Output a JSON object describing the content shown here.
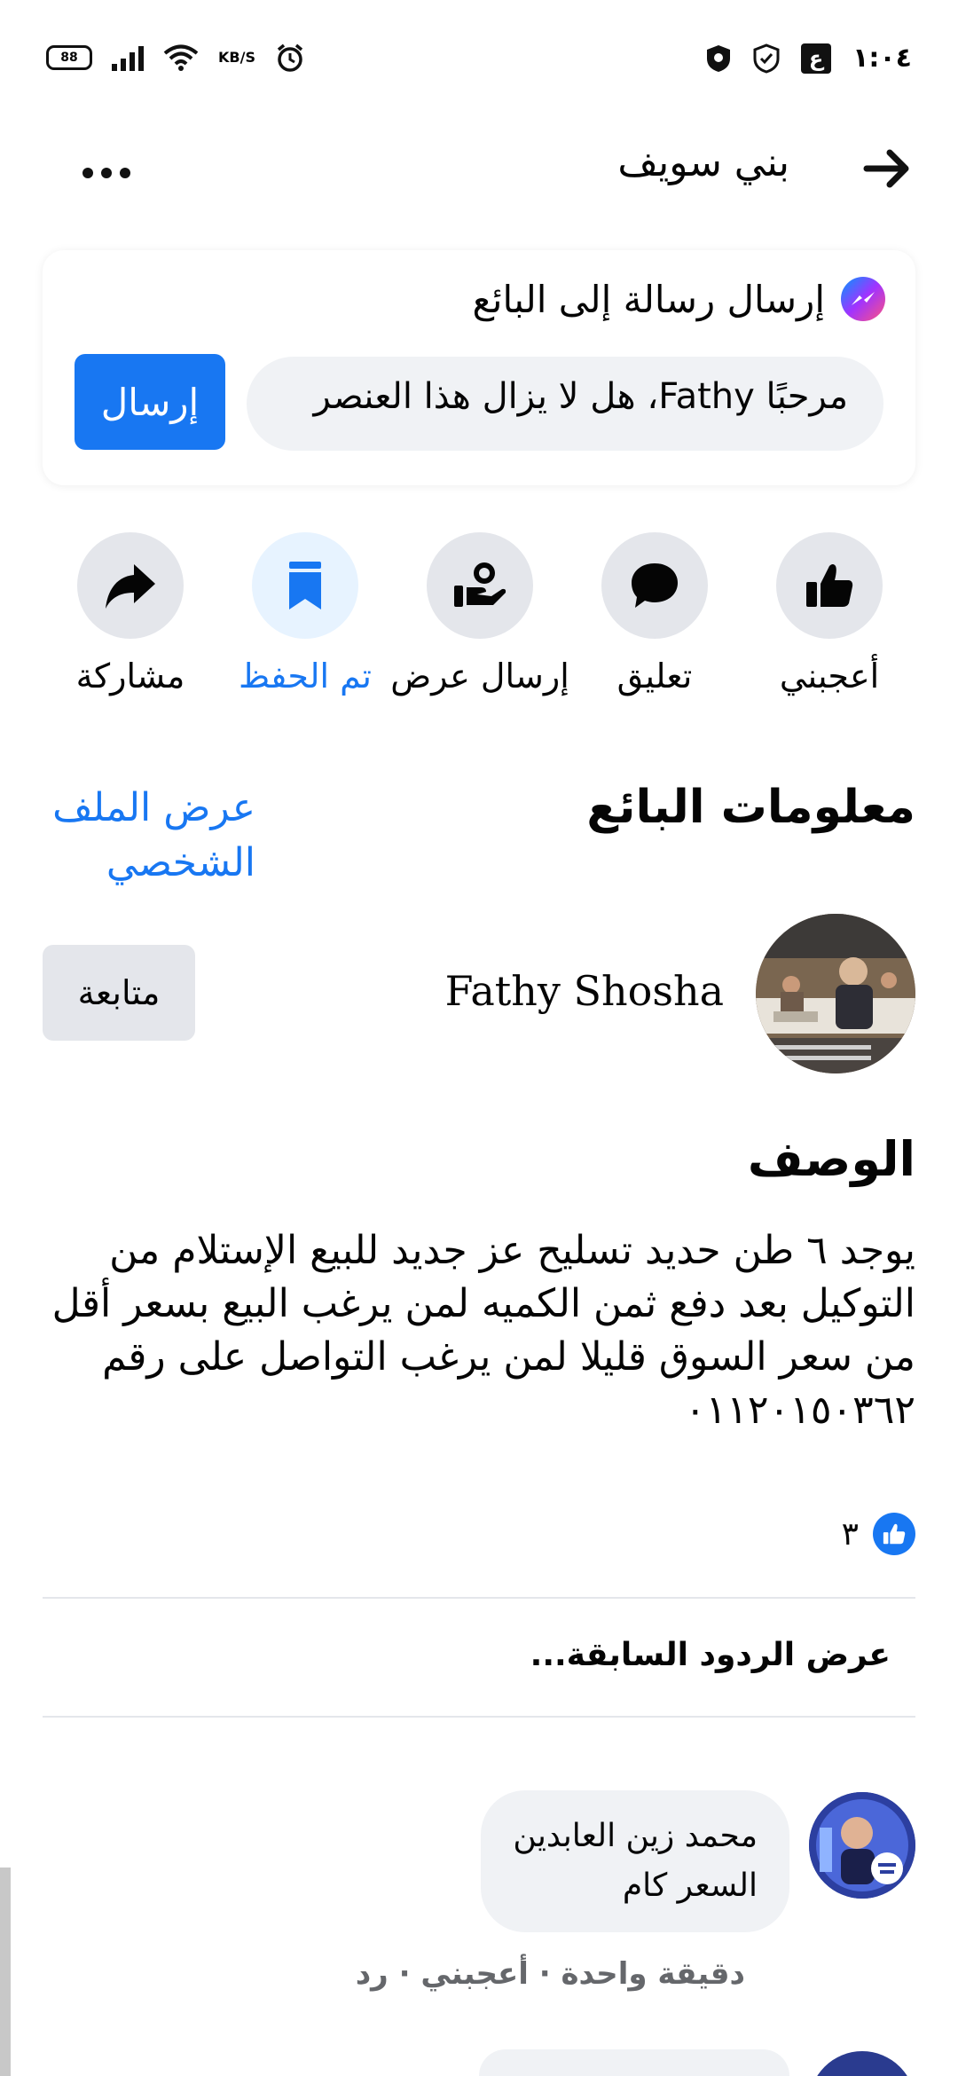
{
  "status_bar": {
    "battery_level": "88",
    "network_speed_unit": "KB/S",
    "time": "١:٠٤",
    "icons": [
      "battery-icon",
      "signal-icon",
      "wifi-icon",
      "alarm-icon",
      "vpn-icon",
      "shield-icon",
      "app-icon"
    ]
  },
  "header": {
    "title": "بني سويف",
    "back_icon": "arrow-right-icon",
    "more_icon": "more-icon"
  },
  "message_card": {
    "title": "إرسال رسالة إلى البائع",
    "input_value": "مرحبًا Fathy، هل لا يزال هذا العنصر",
    "send_label": "إرسال",
    "accent": "#1877f2"
  },
  "actions": [
    {
      "label": "أعجبني",
      "icon": "thumbs-up-icon",
      "saved": false
    },
    {
      "label": "تعليق",
      "icon": "comment-icon",
      "saved": false
    },
    {
      "label": "إرسال عرض",
      "icon": "send-offer-icon",
      "saved": false
    },
    {
      "label": "تم الحفظ",
      "icon": "bookmark-icon",
      "saved": true
    },
    {
      "label": "مشاركة",
      "icon": "share-icon",
      "saved": false
    }
  ],
  "seller": {
    "section_title": "معلومات البائع",
    "view_profile_label": "عرض الملف الشخصي",
    "name": "Fathy Shosha",
    "follow_label": "متابعة"
  },
  "description": {
    "title": "الوصف",
    "text": "يوجد ٦ طن حديد تسليح عز جديد للبيع الإستلام من التوكيل بعد دفع ثمن الكميه لمن يرغب البيع بسعر أقل من سعر السوق قليلا لمن يرغب التواصل على رقم ٠١١٢٠١٥٠٣٦٢"
  },
  "reactions": {
    "like_count": "٣"
  },
  "comments": {
    "view_previous_label": "عرض الردود السابقة...",
    "items": [
      {
        "author": "محمد زين العابدين",
        "text": "السعر كام",
        "meta": "دقيقة واحدة · أعجبني · رد"
      }
    ]
  }
}
